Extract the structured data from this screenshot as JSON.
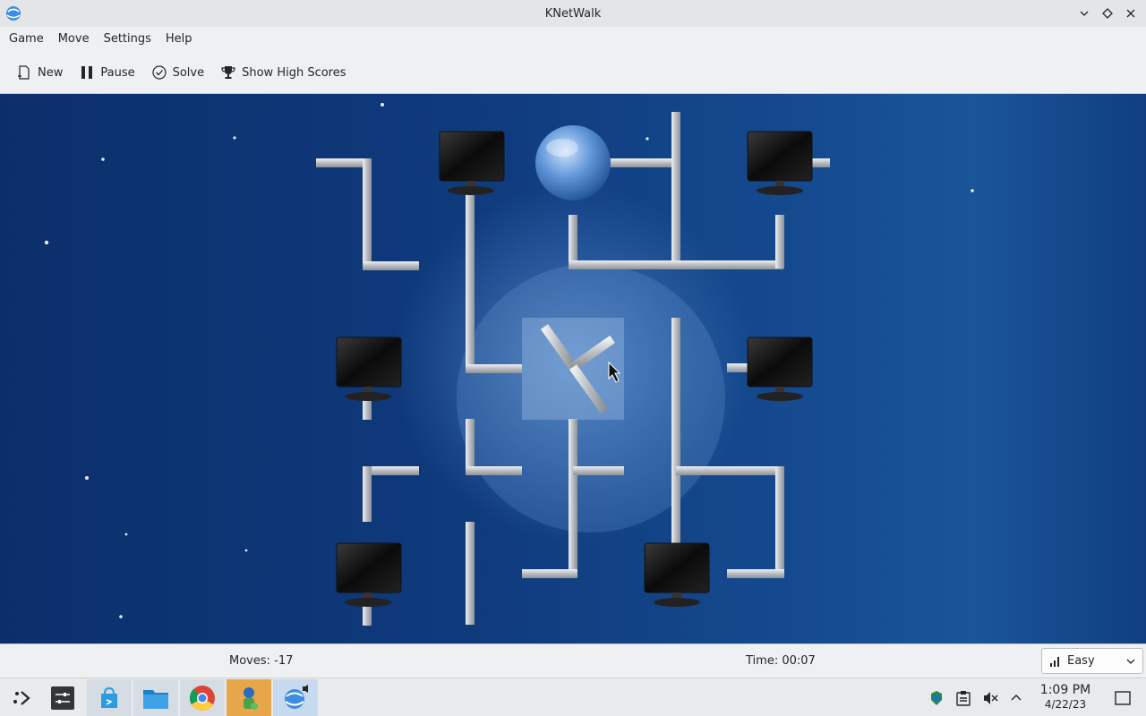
{
  "window": {
    "title": "KNetWalk",
    "app_icon": "knetwalk-globe-icon"
  },
  "menubar": {
    "items": [
      "Game",
      "Move",
      "Settings",
      "Help"
    ]
  },
  "toolbar": {
    "new_label": "New",
    "pause_label": "Pause",
    "solve_label": "Solve",
    "highscores_label": "Show High Scores"
  },
  "game": {
    "background": "#0f3a7c",
    "pipe_color": "#c9ccd0",
    "grid_columns": 5,
    "grid_rows": 5,
    "tiles": [
      {
        "row": 0,
        "col": 0,
        "type": "corner",
        "content": "pipe"
      },
      {
        "row": 0,
        "col": 1,
        "type": "end",
        "content": "computer"
      },
      {
        "row": 0,
        "col": 2,
        "type": "end",
        "content": "server"
      },
      {
        "row": 0,
        "col": 3,
        "type": "t-junction",
        "content": "pipe"
      },
      {
        "row": 0,
        "col": 4,
        "type": "end",
        "content": "computer"
      },
      {
        "row": 1,
        "col": 0,
        "type": "end",
        "content": "computer"
      },
      {
        "row": 1,
        "col": 1,
        "type": "corner",
        "content": "pipe"
      },
      {
        "row": 1,
        "col": 2,
        "type": "t-junction",
        "content": "pipe",
        "selected": true
      },
      {
        "row": 1,
        "col": 3,
        "type": "straight",
        "content": "pipe"
      },
      {
        "row": 1,
        "col": 4,
        "type": "end",
        "content": "computer"
      },
      {
        "row": 2,
        "col": 0,
        "type": "corner",
        "content": "pipe"
      },
      {
        "row": 2,
        "col": 1,
        "type": "corner",
        "content": "pipe"
      },
      {
        "row": 2,
        "col": 2,
        "type": "t-junction",
        "content": "pipe"
      },
      {
        "row": 2,
        "col": 3,
        "type": "t-junction",
        "content": "pipe"
      },
      {
        "row": 2,
        "col": 4,
        "type": "corner",
        "content": "pipe"
      },
      {
        "row": 3,
        "col": 0,
        "type": "end",
        "content": "computer"
      },
      {
        "row": 3,
        "col": 1,
        "type": "straight",
        "content": "pipe"
      },
      {
        "row": 3,
        "col": 2,
        "type": "corner",
        "content": "pipe"
      },
      {
        "row": 3,
        "col": 3,
        "type": "end",
        "content": "computer"
      },
      {
        "row": 3,
        "col": 4,
        "type": "corner",
        "content": "pipe"
      }
    ]
  },
  "status": {
    "moves": "Moves: -17",
    "time": "Time: 00:07",
    "difficulty": "Easy"
  },
  "taskbar": {
    "apps": [
      {
        "name": "application-launcher-icon",
        "state": "none"
      },
      {
        "name": "system-settings-icon",
        "state": "none"
      },
      {
        "name": "discover-store-icon",
        "state": "open"
      },
      {
        "name": "file-manager-icon",
        "state": "open"
      },
      {
        "name": "chrome-browser-icon",
        "state": "open"
      },
      {
        "name": "network-app-icon",
        "state": "open"
      },
      {
        "name": "knetwalk-icon",
        "state": "active"
      }
    ],
    "tray": [
      "updates-icon",
      "clipboard-icon",
      "volume-muted-icon",
      "expand-tray-icon"
    ],
    "clock_time": "1:09 PM",
    "clock_date": "4/22/23"
  }
}
